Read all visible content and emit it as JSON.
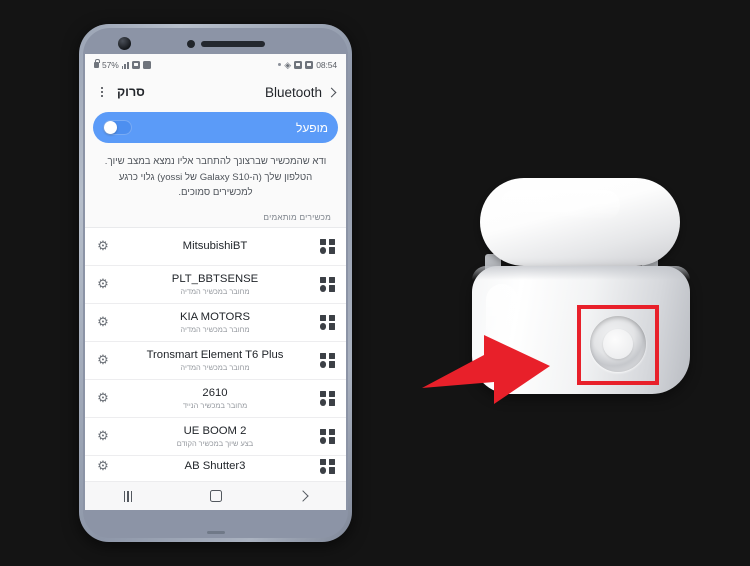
{
  "phone": {
    "status_bar": {
      "lock_icon": "lock-icon",
      "battery_text": "57%",
      "signal_icon": "signal-bars-icon",
      "wifi_icon": "wifi-icon",
      "network_icon": "network-icon",
      "dot_icon": "dot-icon",
      "bluetooth_icon": "bluetooth-icon",
      "alarm_icon": "alarm-icon",
      "screenshot_icon": "screenshot-icon",
      "time": "08:54"
    },
    "header": {
      "overflow_icon": "overflow-menu-icon",
      "scan_label": "סרוק",
      "title": "Bluetooth",
      "chevron_icon": "chevron-right-icon"
    },
    "toggle": {
      "label": "מופעל",
      "state": "on",
      "accent_color": "#5b9bf8"
    },
    "description": "ודא שהמכשיר שברצונך להתחבר אליו נמצא במצב שיוך. הטלפון שלך (ה-Galaxy S10 של yossi) גלוי כרגע למכשירים סמוכים.",
    "paired_section_label": "מכשירים מותאמים",
    "devices": [
      {
        "name": "MitsubishiBT",
        "sub": "",
        "bt_icon": "bluetooth-device-icon",
        "gear_icon": "gear-icon"
      },
      {
        "name": "PLT_BBTSENSE",
        "sub": "מחובר במכשיר המדיה",
        "bt_icon": "bluetooth-device-icon",
        "gear_icon": "gear-icon"
      },
      {
        "name": "KIA MOTORS",
        "sub": "מחובר במכשיר המדיה",
        "bt_icon": "bluetooth-device-icon",
        "gear_icon": "gear-icon"
      },
      {
        "name": "Tronsmart Element T6 Plus",
        "sub": "מחובר במכשיר המדיה",
        "bt_icon": "bluetooth-device-icon",
        "gear_icon": "gear-icon"
      },
      {
        "name": "2610",
        "sub": "מחובר במכשיר הנייד",
        "bt_icon": "bluetooth-device-icon",
        "gear_icon": "gear-icon"
      },
      {
        "name": "UE BOOM 2",
        "sub": "בצע שיוך במכשיר הקודם",
        "bt_icon": "bluetooth-device-icon",
        "gear_icon": "gear-icon"
      },
      {
        "name": "AB Shutter3",
        "sub": "",
        "bt_icon": "bluetooth-device-icon",
        "gear_icon": "gear-icon"
      }
    ],
    "nav_bar": {
      "recents_icon": "recents-icon",
      "home_icon": "home-icon",
      "back_icon": "back-icon"
    }
  },
  "illustration": {
    "subject": "airpods-charging-case",
    "pairing_button_label": "pairing-button",
    "highlight_color": "#e8202a",
    "arrow_color": "#e8202a"
  },
  "background_color": "#141414"
}
